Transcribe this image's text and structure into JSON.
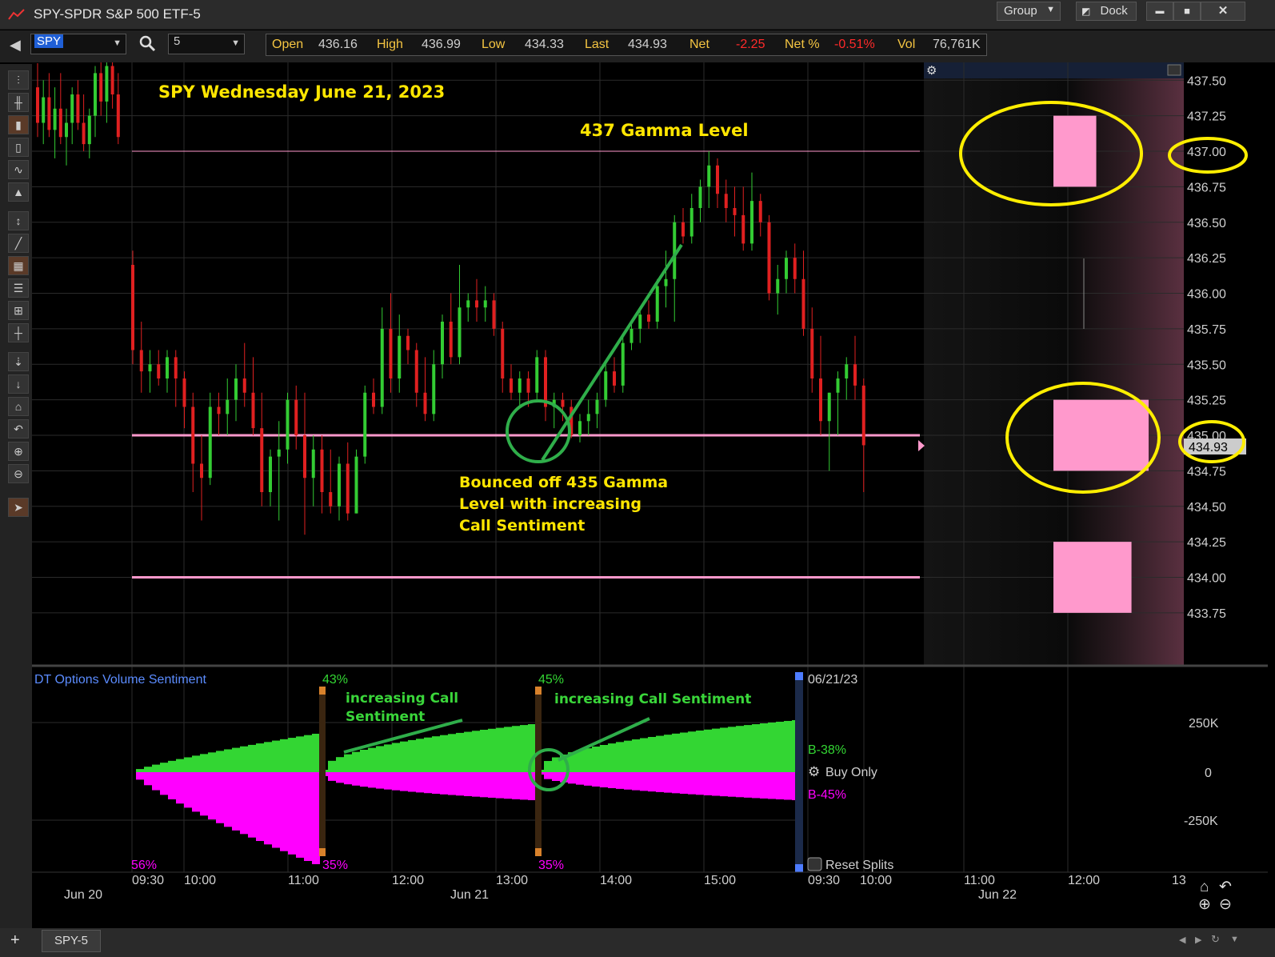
{
  "window": {
    "title": "SPY-SPDR S&P 500 ETF-5",
    "group_label": "Group",
    "dock_label": "Dock",
    "min_label": "▬",
    "max_label": "■",
    "close_label": "✕"
  },
  "toolbar": {
    "symbol": "SPY",
    "interval": "5",
    "quotes": [
      {
        "label": "Open",
        "value": "436.16",
        "neg": false
      },
      {
        "label": "High",
        "value": "436.99",
        "neg": false
      },
      {
        "label": "Low",
        "value": "434.33",
        "neg": false
      },
      {
        "label": "Last",
        "value": "434.93",
        "neg": false
      },
      {
        "label": "Net",
        "value": "-2.25",
        "neg": true
      },
      {
        "label": "Net %",
        "value": "-0.51%",
        "neg": true
      },
      {
        "label": "Vol",
        "value": "76,761K",
        "neg": false
      }
    ]
  },
  "annotations": {
    "title": "SPY Wednesday June 21, 2023",
    "gamma437": "437 Gamma Level",
    "bounce_line1": "Bounced off 435 Gamma",
    "bounce_line2": "Level with increasing",
    "bounce_line3": "Call Sentiment",
    "inc_call_1a": "increasing Call",
    "inc_call_1b": "Sentiment",
    "inc_call_2": "increasing Call Sentiment"
  },
  "price_axis": {
    "labels": [
      "437.50",
      "437.25",
      "437.00",
      "436.75",
      "436.50",
      "436.25",
      "436.00",
      "435.75",
      "435.50",
      "435.25",
      "435.00",
      "434.75",
      "434.50",
      "434.25",
      "434.00",
      "433.75"
    ],
    "last_price": "434.93"
  },
  "indicator": {
    "name": "DT Options Volume Sentiment",
    "axis_labels": [
      "250K",
      "0",
      "-250K"
    ],
    "pct_top_1": "43%",
    "pct_top_2": "45%",
    "pct_bot_0": "56%",
    "pct_bot_1": "35%",
    "pct_bot_2": "35%",
    "date_label": "06/21/23",
    "b_call": "B-38%",
    "b_put": "B-45%",
    "buy_only": "Buy Only",
    "reset_splits": "Reset Splits",
    "colors": {
      "call": "#33d633",
      "put": "#ff00ff"
    }
  },
  "time_axis": {
    "times": [
      "09:30",
      "10:00",
      "11:00",
      "12:00",
      "13:00",
      "14:00",
      "15:00",
      "09:30",
      "10:00",
      "11:00",
      "12:00",
      "13"
    ],
    "dates": [
      "Jun 20",
      "Jun 21",
      "Jun 22"
    ]
  },
  "tabs": {
    "active": "SPY-5"
  },
  "chart_data": {
    "type": "candlestick",
    "title": "SPY Wednesday June 21, 2023",
    "interval_minutes": 5,
    "gamma_levels": [
      437.0,
      435.0,
      434.0
    ],
    "profile_levels": [
      {
        "low": 436.75,
        "high": 437.25,
        "weight": 0.45
      },
      {
        "low": 434.75,
        "high": 435.25,
        "weight": 1.0
      },
      {
        "low": 433.75,
        "high": 434.25,
        "weight": 0.82
      }
    ],
    "candles_jun20": [
      {
        "o": 437.45,
        "h": 437.62,
        "l": 437.1,
        "c": 437.2
      },
      {
        "o": 437.2,
        "h": 437.5,
        "l": 437.05,
        "c": 437.38
      },
      {
        "o": 437.38,
        "h": 437.55,
        "l": 437.1,
        "c": 437.15
      },
      {
        "o": 437.15,
        "h": 437.45,
        "l": 436.95,
        "c": 437.3
      },
      {
        "o": 437.3,
        "h": 437.55,
        "l": 437.05,
        "c": 437.1
      },
      {
        "o": 437.1,
        "h": 437.3,
        "l": 436.9,
        "c": 437.2
      },
      {
        "o": 437.2,
        "h": 437.45,
        "l": 437.05,
        "c": 437.4
      },
      {
        "o": 437.4,
        "h": 437.5,
        "l": 437.15,
        "c": 437.2
      },
      {
        "o": 437.2,
        "h": 437.4,
        "l": 437.0,
        "c": 437.05
      },
      {
        "o": 437.05,
        "h": 437.3,
        "l": 436.95,
        "c": 437.25
      },
      {
        "o": 437.25,
        "h": 437.6,
        "l": 437.1,
        "c": 437.55
      },
      {
        "o": 437.55,
        "h": 437.7,
        "l": 437.25,
        "c": 437.35
      },
      {
        "o": 437.35,
        "h": 437.65,
        "l": 437.2,
        "c": 437.6
      },
      {
        "o": 437.6,
        "h": 437.7,
        "l": 437.3,
        "c": 437.4
      },
      {
        "o": 437.4,
        "h": 437.55,
        "l": 437.05,
        "c": 437.1
      }
    ],
    "candles_jun21": [
      {
        "o": 436.2,
        "h": 436.3,
        "l": 435.5,
        "c": 435.6
      },
      {
        "o": 435.6,
        "h": 435.8,
        "l": 435.3,
        "c": 435.45
      },
      {
        "o": 435.45,
        "h": 435.6,
        "l": 435.3,
        "c": 435.5
      },
      {
        "o": 435.5,
        "h": 435.6,
        "l": 435.35,
        "c": 435.4
      },
      {
        "o": 435.4,
        "h": 435.6,
        "l": 435.3,
        "c": 435.55
      },
      {
        "o": 435.55,
        "h": 435.6,
        "l": 435.2,
        "c": 435.4
      },
      {
        "o": 435.4,
        "h": 435.45,
        "l": 435.05,
        "c": 435.2
      },
      {
        "o": 435.2,
        "h": 435.3,
        "l": 434.6,
        "c": 434.8
      },
      {
        "o": 434.8,
        "h": 435.0,
        "l": 434.4,
        "c": 434.7
      },
      {
        "o": 434.7,
        "h": 435.3,
        "l": 434.65,
        "c": 435.2
      },
      {
        "o": 435.2,
        "h": 435.3,
        "l": 435.0,
        "c": 435.15
      },
      {
        "o": 435.15,
        "h": 435.4,
        "l": 435.0,
        "c": 435.25
      },
      {
        "o": 435.25,
        "h": 435.5,
        "l": 435.1,
        "c": 435.4
      },
      {
        "o": 435.4,
        "h": 435.65,
        "l": 435.2,
        "c": 435.3
      },
      {
        "o": 435.3,
        "h": 435.55,
        "l": 435.0,
        "c": 435.05
      },
      {
        "o": 435.05,
        "h": 435.3,
        "l": 434.5,
        "c": 434.6
      },
      {
        "o": 434.6,
        "h": 434.9,
        "l": 434.5,
        "c": 434.85
      },
      {
        "o": 434.85,
        "h": 435.1,
        "l": 434.4,
        "c": 434.9
      },
      {
        "o": 434.9,
        "h": 435.3,
        "l": 434.8,
        "c": 435.25
      },
      {
        "o": 435.25,
        "h": 435.35,
        "l": 434.9,
        "c": 435.0
      },
      {
        "o": 435.0,
        "h": 435.3,
        "l": 434.3,
        "c": 434.7
      },
      {
        "o": 434.7,
        "h": 435.0,
        "l": 434.5,
        "c": 434.9
      },
      {
        "o": 434.9,
        "h": 435.0,
        "l": 434.45,
        "c": 434.6
      },
      {
        "o": 434.6,
        "h": 434.9,
        "l": 434.45,
        "c": 434.5
      },
      {
        "o": 434.5,
        "h": 434.85,
        "l": 434.4,
        "c": 434.8
      },
      {
        "o": 434.8,
        "h": 434.95,
        "l": 434.4,
        "c": 434.45
      },
      {
        "o": 434.45,
        "h": 434.9,
        "l": 434.45,
        "c": 434.85
      },
      {
        "o": 434.85,
        "h": 435.35,
        "l": 434.8,
        "c": 435.3
      },
      {
        "o": 435.3,
        "h": 435.4,
        "l": 435.15,
        "c": 435.2
      },
      {
        "o": 435.2,
        "h": 435.9,
        "l": 435.15,
        "c": 435.75
      },
      {
        "o": 435.75,
        "h": 436.0,
        "l": 435.3,
        "c": 435.4
      },
      {
        "o": 435.4,
        "h": 435.85,
        "l": 435.3,
        "c": 435.7
      },
      {
        "o": 435.7,
        "h": 435.75,
        "l": 435.5,
        "c": 435.6
      },
      {
        "o": 435.6,
        "h": 435.65,
        "l": 435.2,
        "c": 435.3
      },
      {
        "o": 435.3,
        "h": 435.55,
        "l": 435.1,
        "c": 435.15
      },
      {
        "o": 435.15,
        "h": 435.6,
        "l": 435.1,
        "c": 435.5
      },
      {
        "o": 435.5,
        "h": 435.85,
        "l": 435.4,
        "c": 435.8
      },
      {
        "o": 435.8,
        "h": 436.0,
        "l": 435.5,
        "c": 435.55
      },
      {
        "o": 435.55,
        "h": 436.2,
        "l": 435.5,
        "c": 435.9
      },
      {
        "o": 435.9,
        "h": 436.0,
        "l": 435.8,
        "c": 435.95
      },
      {
        "o": 435.95,
        "h": 436.1,
        "l": 435.8,
        "c": 435.9
      },
      {
        "o": 435.9,
        "h": 436.05,
        "l": 435.8,
        "c": 435.95
      },
      {
        "o": 435.95,
        "h": 436.0,
        "l": 435.7,
        "c": 435.75
      },
      {
        "o": 435.75,
        "h": 435.8,
        "l": 435.3,
        "c": 435.4
      },
      {
        "o": 435.4,
        "h": 435.5,
        "l": 435.25,
        "c": 435.3
      },
      {
        "o": 435.3,
        "h": 435.45,
        "l": 435.2,
        "c": 435.4
      },
      {
        "o": 435.4,
        "h": 435.45,
        "l": 435.2,
        "c": 435.3
      },
      {
        "o": 435.3,
        "h": 435.6,
        "l": 435.25,
        "c": 435.55
      },
      {
        "o": 435.55,
        "h": 435.6,
        "l": 435.1,
        "c": 435.2
      },
      {
        "o": 435.2,
        "h": 435.3,
        "l": 435.05,
        "c": 435.25
      },
      {
        "o": 435.25,
        "h": 435.3,
        "l": 435.1,
        "c": 435.2
      },
      {
        "o": 435.2,
        "h": 435.25,
        "l": 434.98,
        "c": 435.0
      },
      {
        "o": 435.0,
        "h": 435.15,
        "l": 434.95,
        "c": 435.1
      },
      {
        "o": 435.1,
        "h": 435.25,
        "l": 435.0,
        "c": 435.15
      },
      {
        "o": 435.15,
        "h": 435.3,
        "l": 435.05,
        "c": 435.25
      },
      {
        "o": 435.25,
        "h": 435.5,
        "l": 435.2,
        "c": 435.45
      },
      {
        "o": 435.45,
        "h": 435.55,
        "l": 435.3,
        "c": 435.35
      },
      {
        "o": 435.35,
        "h": 435.7,
        "l": 435.3,
        "c": 435.65
      },
      {
        "o": 435.65,
        "h": 435.8,
        "l": 435.6,
        "c": 435.75
      },
      {
        "o": 435.75,
        "h": 435.9,
        "l": 435.65,
        "c": 435.85
      },
      {
        "o": 435.85,
        "h": 435.95,
        "l": 435.75,
        "c": 435.8
      },
      {
        "o": 435.8,
        "h": 436.1,
        "l": 435.75,
        "c": 436.05
      },
      {
        "o": 436.05,
        "h": 436.3,
        "l": 435.9,
        "c": 436.1
      },
      {
        "o": 436.1,
        "h": 436.55,
        "l": 435.8,
        "c": 436.5
      },
      {
        "o": 436.5,
        "h": 436.6,
        "l": 436.35,
        "c": 436.4
      },
      {
        "o": 436.4,
        "h": 436.7,
        "l": 436.35,
        "c": 436.6
      },
      {
        "o": 436.6,
        "h": 436.8,
        "l": 436.5,
        "c": 436.75
      },
      {
        "o": 436.75,
        "h": 437.0,
        "l": 436.6,
        "c": 436.9
      },
      {
        "o": 436.9,
        "h": 436.95,
        "l": 436.6,
        "c": 436.7
      },
      {
        "o": 436.7,
        "h": 436.8,
        "l": 436.5,
        "c": 436.6
      },
      {
        "o": 436.6,
        "h": 436.75,
        "l": 436.4,
        "c": 436.55
      },
      {
        "o": 436.55,
        "h": 436.75,
        "l": 436.3,
        "c": 436.35
      },
      {
        "o": 436.35,
        "h": 436.85,
        "l": 436.3,
        "c": 436.65
      },
      {
        "o": 436.65,
        "h": 436.7,
        "l": 436.4,
        "c": 436.5
      },
      {
        "o": 436.5,
        "h": 436.55,
        "l": 435.95,
        "c": 436.0
      },
      {
        "o": 436.0,
        "h": 436.2,
        "l": 435.85,
        "c": 436.1
      },
      {
        "o": 436.1,
        "h": 436.3,
        "l": 436.0,
        "c": 436.25
      },
      {
        "o": 436.25,
        "h": 436.35,
        "l": 436.0,
        "c": 436.1
      },
      {
        "o": 436.1,
        "h": 436.3,
        "l": 435.7,
        "c": 435.75
      },
      {
        "o": 435.75,
        "h": 435.9,
        "l": 435.3,
        "c": 435.4
      },
      {
        "o": 435.4,
        "h": 435.7,
        "l": 435.0,
        "c": 435.1
      },
      {
        "o": 435.1,
        "h": 435.3,
        "l": 434.75,
        "c": 435.3
      },
      {
        "o": 435.3,
        "h": 435.45,
        "l": 435.0,
        "c": 435.4
      },
      {
        "o": 435.4,
        "h": 435.55,
        "l": 435.25,
        "c": 435.5
      },
      {
        "o": 435.5,
        "h": 435.7,
        "l": 435.25,
        "c": 435.35
      },
      {
        "o": 435.35,
        "h": 435.4,
        "l": 434.6,
        "c": 434.93
      }
    ]
  }
}
